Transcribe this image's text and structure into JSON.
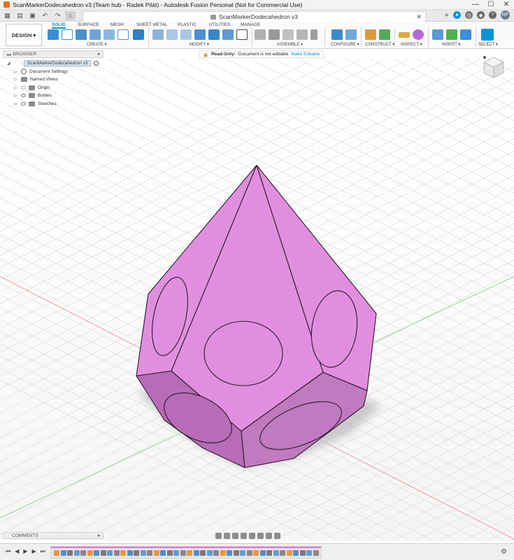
{
  "window": {
    "title": "ScanMarkerDodecahedron v3 (Team hub - Radek Pilát) - Autodesk Fusion Personal (Not for Commercial Use)",
    "min": "—",
    "max": "☐",
    "close": "✕"
  },
  "document_tab": {
    "title": "ScanMarkerDodecahedron v3",
    "close": "✕",
    "new": "+"
  },
  "qat_right": {
    "help": "?",
    "profile": "RP"
  },
  "workspace_button": "DESIGN ▾",
  "ribbon": {
    "tabs": [
      "SOLID",
      "SURFACE",
      "MESH",
      "SHEET METAL",
      "PLASTIC",
      "UTILITIES",
      "MANAGE"
    ],
    "active_tab": "SOLID",
    "groups": [
      "CREATE ▾",
      "MODIFY ▾",
      "ASSEMBLE ▾",
      "CONFIGURE ▾",
      "CONSTRUCT ▾",
      "INSPECT ▾",
      "INSERT ▾",
      "SELECT ▾"
    ]
  },
  "browser": {
    "header": "BROWSER",
    "root": "ScanMarkerDodecahedron v3",
    "items": [
      "Document Settings",
      "Named Views",
      "Origin",
      "Bodies",
      "Sketches"
    ]
  },
  "readonly_banner": {
    "label": "Read-Only:",
    "message": "Document is not editable",
    "action": "Make Editable"
  },
  "comments": {
    "label": "COMMENTS"
  },
  "colors": {
    "accent": "#0696d7",
    "body": "#e28ee0",
    "body_dark": "#b86cb7",
    "timeline_bar": "#e070d8"
  }
}
